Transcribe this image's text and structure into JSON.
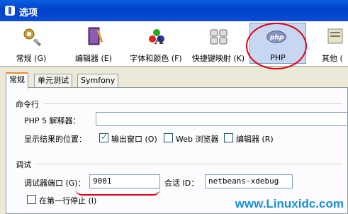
{
  "window": {
    "title": "选项"
  },
  "toolbar": {
    "items": [
      {
        "label": "常规 (G)",
        "icon": "gears-icon"
      },
      {
        "label": "编辑器 (E)",
        "icon": "book-pen-icon"
      },
      {
        "label": "字体和颜色 (F)",
        "icon": "font-color-icon"
      },
      {
        "label": "快捷键映射 (K)",
        "icon": "keyboard-icon"
      },
      {
        "label": "PHP",
        "icon": "php-icon",
        "selected": true
      },
      {
        "label": "其他 (",
        "icon": "misc-icon"
      }
    ]
  },
  "tabs": [
    {
      "label": "常规",
      "active": true
    },
    {
      "label": "单元测试"
    },
    {
      "label": "Symfony"
    }
  ],
  "command_line": {
    "section_label": "命令行",
    "interpreter_label": "PHP 5 解释器：",
    "interpreter_value": "",
    "output_label": "显示结果的位置：",
    "options": [
      {
        "label": "输出窗口 (O)",
        "checked": true
      },
      {
        "label": "Web 浏览器",
        "checked": false
      },
      {
        "label": "编辑器 (R)",
        "checked": false
      }
    ]
  },
  "debug": {
    "section_label": "调试",
    "port_label": "调试器端口 (G)：",
    "port_value": "9001",
    "session_label": "会话 ID：",
    "session_value": "netbeans-xdebug",
    "stop_first_line_label": "在第一行停止 (I)",
    "stop_first_line_checked": false
  },
  "watermark": "www.Linuxidc.com",
  "colors": {
    "annotation": "#e0001a",
    "titlebar": "#0042c8",
    "watermark": "#1a8fd6"
  }
}
